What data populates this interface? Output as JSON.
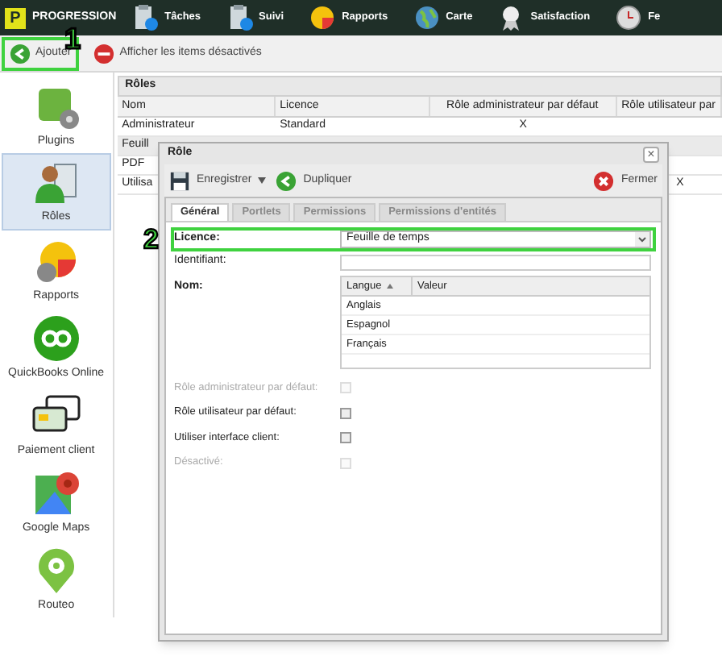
{
  "top_nav": {
    "logo_letter": "P",
    "brand": "PROGRESSION",
    "items": [
      {
        "label": "Tâches",
        "kind": "task"
      },
      {
        "label": "Suivi",
        "kind": "task"
      },
      {
        "label": "Rapports",
        "kind": "report"
      },
      {
        "label": "Carte",
        "kind": "globe"
      },
      {
        "label": "Satisfaction",
        "kind": "award"
      },
      {
        "label": "Fe",
        "kind": "clock"
      }
    ]
  },
  "toolbar": {
    "buttons": [
      {
        "label": "Ajouter",
        "kind": "add",
        "highlighted": true
      },
      {
        "label": "Afficher les items désactivés",
        "kind": "remove",
        "highlighted": false
      }
    ]
  },
  "annotations": [
    {
      "label": "1"
    },
    {
      "label": "2"
    }
  ],
  "sidebar": {
    "items": [
      {
        "label": "Plugins",
        "kind": "plugins",
        "selected": false
      },
      {
        "label": "Rôles",
        "kind": "roles",
        "selected": true
      },
      {
        "label": "Rapports",
        "kind": "reports",
        "selected": false
      },
      {
        "label": "QuickBooks Online",
        "kind": "qb",
        "selected": false
      },
      {
        "label": "Paiement client",
        "kind": "card",
        "selected": false
      },
      {
        "label": "Google Maps",
        "kind": "map",
        "selected": false
      },
      {
        "label": "Routeo",
        "kind": "pin",
        "selected": false
      }
    ]
  },
  "roles_panel": {
    "title": "Rôles",
    "columns": [
      "Nom",
      "Licence",
      "Rôle administrateur par défaut",
      "Rôle utilisateur par"
    ],
    "rows": [
      {
        "name": "Administrateur",
        "licence": "Standard",
        "admin_default": "X"
      },
      {
        "name": "Feuill"
      },
      {
        "name": "PDF"
      },
      {
        "name": "Utilisa",
        "user_default": "X"
      }
    ]
  },
  "dialog": {
    "title": "Rôle",
    "close": "×",
    "toolbar": [
      {
        "label": "Enregistrer",
        "kind": "save"
      },
      {
        "label": "Dupliquer",
        "kind": "duplicate"
      },
      {
        "label": "Fermer",
        "kind": "close"
      }
    ],
    "tabs": [
      {
        "label": "Général",
        "selected": true
      },
      {
        "label": "Portlets",
        "selected": false
      },
      {
        "label": "Permissions",
        "selected": false
      },
      {
        "label": "Permissions d'entités",
        "selected": false
      }
    ],
    "licence": {
      "label": "Licence:",
      "value": "Feuille de temps",
      "highlighted": true
    },
    "identifiant": {
      "label": "Identifiant:"
    },
    "nom": {
      "label": "Nom:",
      "columns": [
        "Langue",
        "Valeur"
      ],
      "rows": [
        "Anglais",
        "Espagnol",
        "Français"
      ]
    },
    "checkboxes": [
      {
        "label": "Rôle administrateur par défaut:",
        "disabled": true,
        "checked": false
      },
      {
        "label": "Rôle utilisateur par défaut:",
        "disabled": false,
        "checked": false
      },
      {
        "label": "Utiliser interface client:",
        "disabled": false,
        "checked": false
      },
      {
        "label": "Désactivé:",
        "disabled": true,
        "checked": false
      }
    ]
  }
}
